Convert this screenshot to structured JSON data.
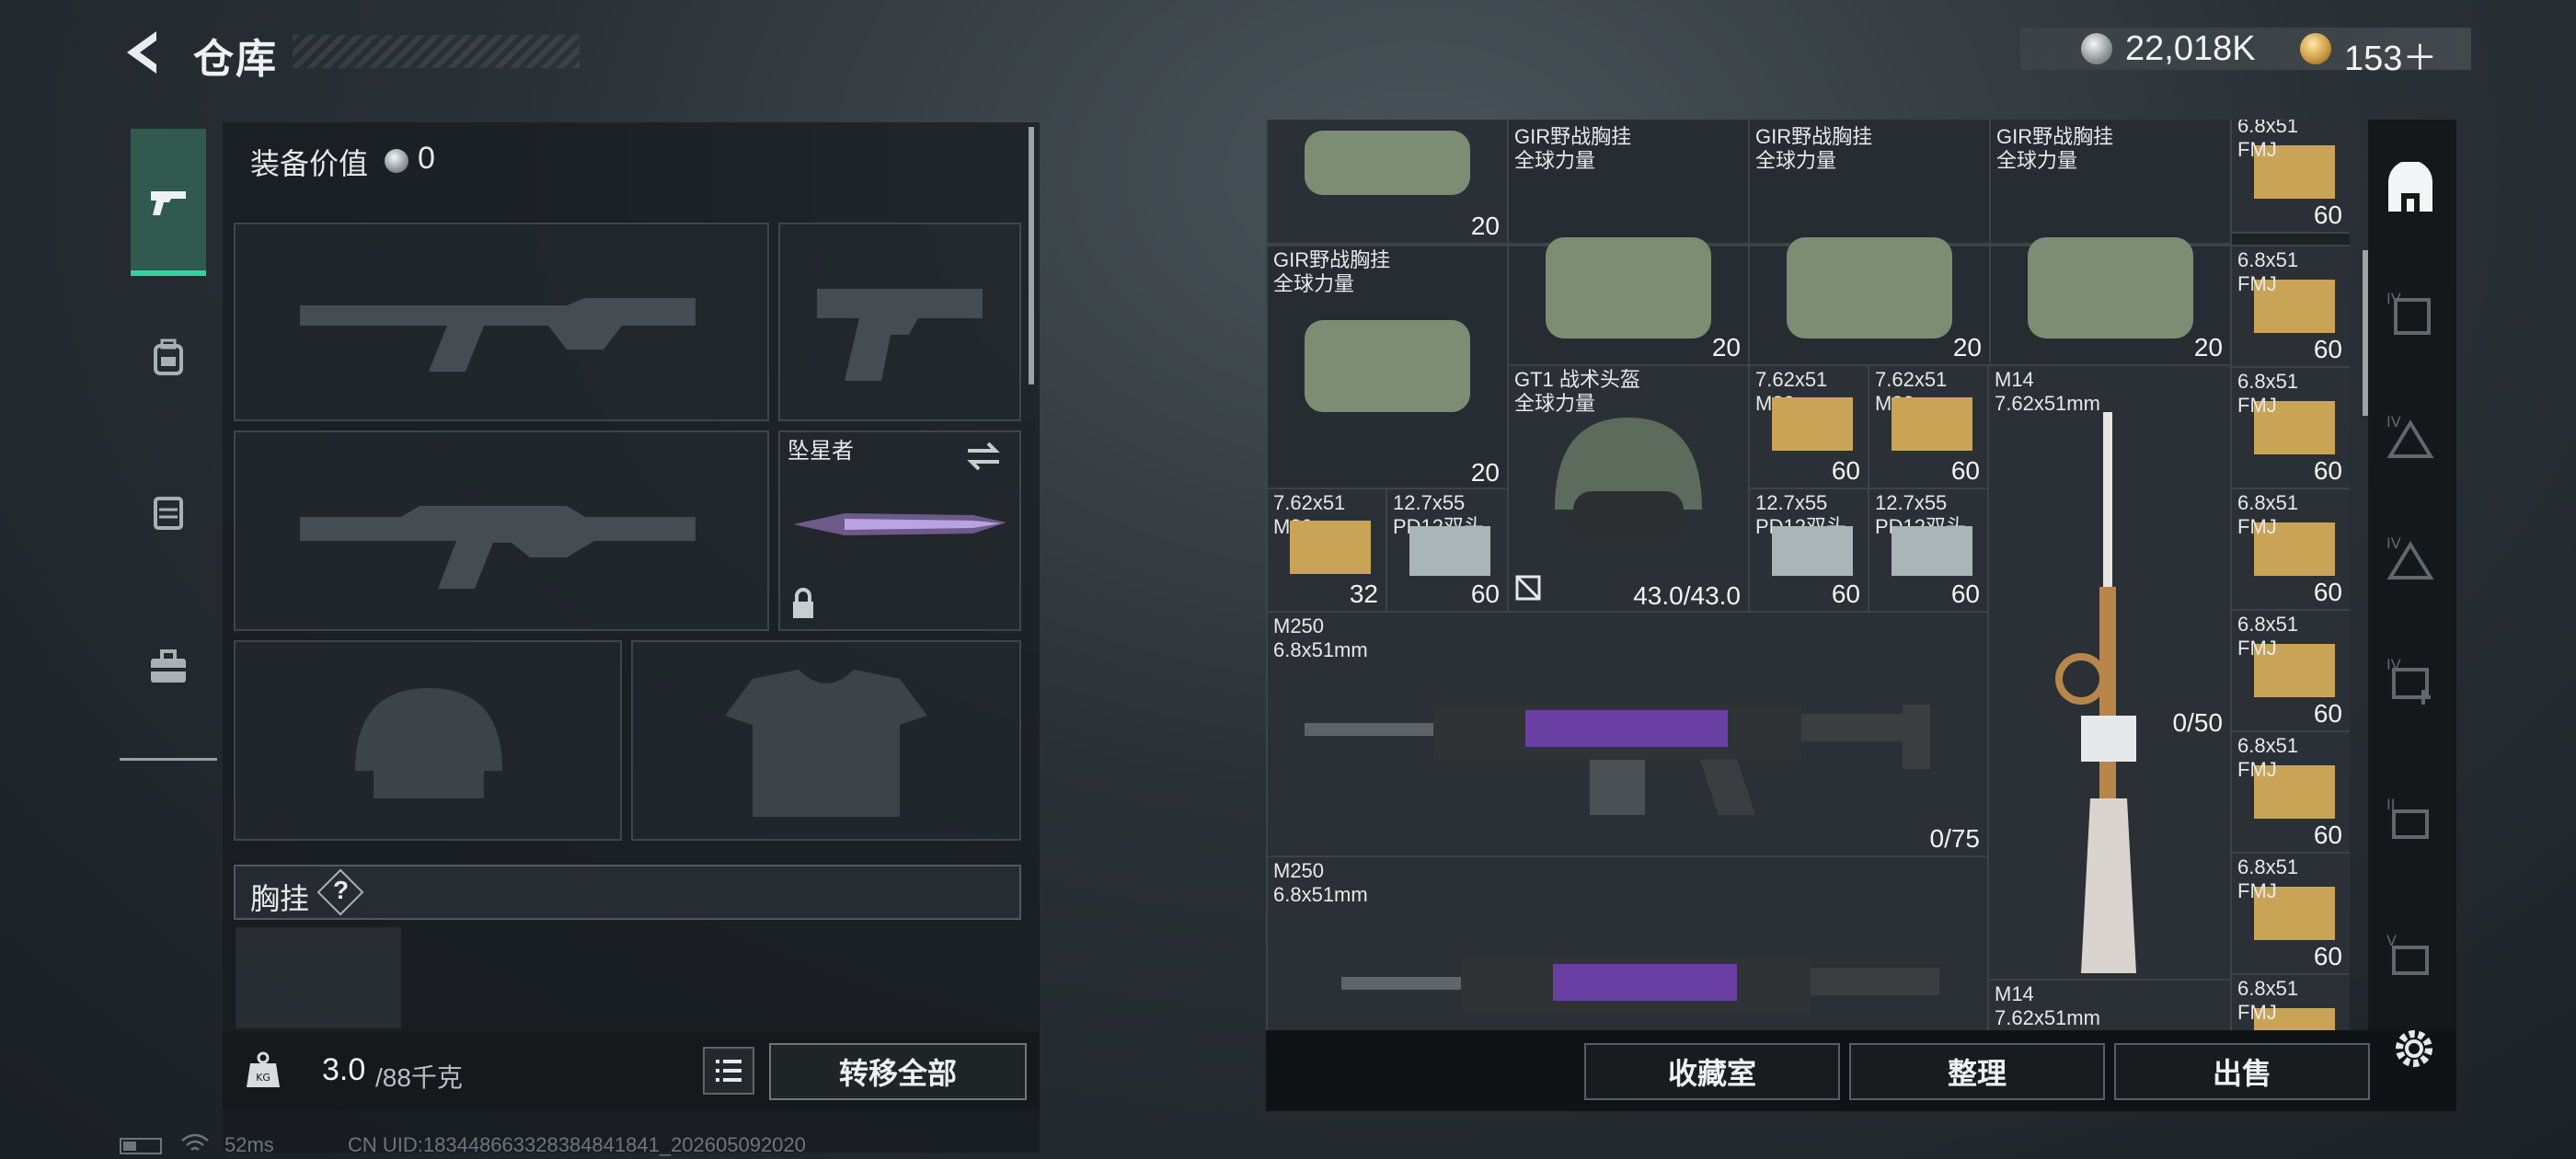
{
  "header": {
    "title": "仓库",
    "silver_amount": "22,018K",
    "gold_amount": "153＋"
  },
  "loadout": {
    "equip_value_label": "装备价值",
    "equip_value": "0",
    "knife_name": "坠星者",
    "chest_label": "胸挂",
    "chest_help": "?",
    "weight_value": "3.0",
    "weight_max": "/88千克",
    "weight_icon_label": "KG",
    "transfer_all": "转移全部"
  },
  "status": {
    "ping": "52ms",
    "uid": "CN UID:18344866332838484184​1_202605092020"
  },
  "storage": {
    "items": {
      "bag_a_count": "20",
      "chest_rig_name_1": "GIR野战胸挂",
      "chest_rig_sub_1": "全球力量",
      "chest_rig_count_1": "20",
      "chest_rig_name_2": "GIR野战胸挂",
      "chest_rig_sub_2": "全球力量",
      "chest_rig_count_2": "20",
      "chest_rig_name_3": "GIR野战胸挂",
      "chest_rig_sub_3": "全球力量",
      "chest_rig_count_3": "20",
      "chest_rig_name_4": "GIR野战胸挂",
      "chest_rig_sub_4": "全球力量",
      "chest_rig_count_4": "20",
      "helmet_name": "GT1 战术头盔",
      "helmet_sub": "全球力量",
      "helmet_durability": "43.0/43.0",
      "ammo_762_name": "7.62x51",
      "ammo_762_sub": "M80",
      "ammo_762_count_a": "60",
      "ammo_762_count_b": "60",
      "ammo_762_count_c": "32",
      "ammo_127_name": "12.7x55",
      "ammo_127_sub": "PD12双头",
      "ammo_127_count_a": "60",
      "ammo_127_count_b": "60",
      "ammo_127_count_c": "60",
      "m14_name": "M14",
      "m14_caliber": "7.62x51mm",
      "m14_ammo": "0/50",
      "m250_name": "M250",
      "m250_caliber": "6.8x51mm",
      "m250_ammo": "0/75",
      "m250b_name": "M250",
      "m250b_caliber": "6.8x51mm",
      "m14b_name": "M14",
      "m14b_caliber": "7.62x51mm",
      "ammo_68_name": "6.8x51",
      "ammo_68_sub": "FMJ",
      "ammo_68_count": "60"
    }
  },
  "buttons": {
    "collection": "收藏室",
    "sort": "整理",
    "sell": "出售"
  },
  "icons": {
    "back": "chevron-left-icon",
    "pistol_tab": "pistol-icon",
    "backpack_tab": "backpack-icon",
    "rig_tab": "rig-icon",
    "toolbox_tab": "toolbox-icon",
    "settings": "gear-icon"
  },
  "colors": {
    "accent_green": "#33d2a1",
    "gold": "#c9a457"
  }
}
